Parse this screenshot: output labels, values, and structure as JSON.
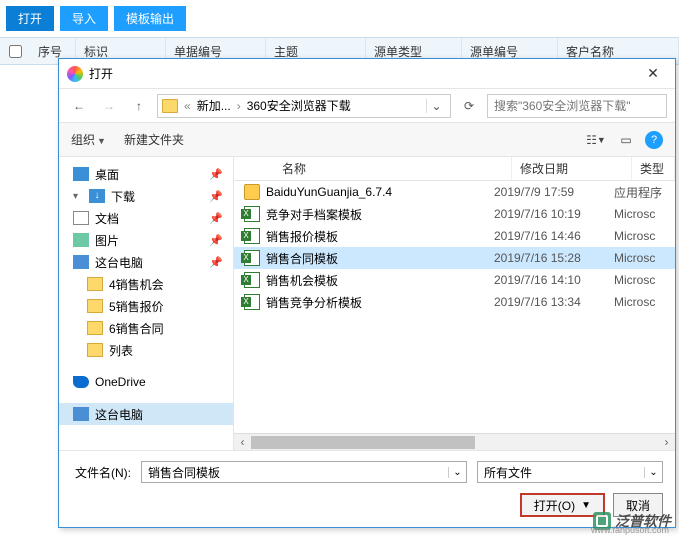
{
  "toolbar": {
    "open": "打开",
    "import": "导入",
    "template_out": "模板输出"
  },
  "grid": {
    "cols": {
      "seq": "序号",
      "mark": "标识",
      "bill_no": "单据编号",
      "subject": "主题",
      "src_type": "源单类型",
      "src_no": "源单编号",
      "cust": "客户名称"
    }
  },
  "dialog": {
    "title": "打开",
    "nav": {
      "crumb1": "新加...",
      "crumb2": "360安全浏览器下载",
      "search_ph": "搜索\"360安全浏览器下载\""
    },
    "cmd": {
      "org": "组织",
      "newf": "新建文件夹"
    },
    "tree": [
      {
        "label": "桌面",
        "icon": "desk",
        "pin": true
      },
      {
        "label": "下载",
        "icon": "down",
        "pin": true,
        "expanded": true
      },
      {
        "label": "文档",
        "icon": "doc",
        "pin": true
      },
      {
        "label": "图片",
        "icon": "pic",
        "pin": true
      },
      {
        "label": "这台电脑",
        "icon": "pc",
        "pin": true
      },
      {
        "label": "4销售机会",
        "icon": "fold",
        "sub": true
      },
      {
        "label": "5销售报价",
        "icon": "fold",
        "sub": true
      },
      {
        "label": "6销售合同",
        "icon": "fold",
        "sub": true
      },
      {
        "label": "列表",
        "icon": "fold",
        "sub": true
      },
      {
        "label": "",
        "icon": "",
        "spacer": true
      },
      {
        "label": "OneDrive",
        "icon": "one"
      },
      {
        "label": "",
        "icon": "",
        "spacer": true
      },
      {
        "label": "这台电脑",
        "icon": "pc",
        "sel": true
      }
    ],
    "files": {
      "hdr": {
        "name": "名称",
        "date": "修改日期",
        "type": "类型"
      },
      "rows": [
        {
          "icon": "exe",
          "name": "BaiduYunGuanjia_6.7.4",
          "date": "2019/7/9 17:59",
          "type": "应用程序"
        },
        {
          "icon": "xls",
          "name": "竞争对手档案模板",
          "date": "2019/7/16 10:19",
          "type": "Microsc"
        },
        {
          "icon": "xls",
          "name": "销售报价模板",
          "date": "2019/7/16 14:46",
          "type": "Microsc"
        },
        {
          "icon": "xls",
          "name": "销售合同模板",
          "date": "2019/7/16 15:28",
          "type": "Microsc",
          "sel": true
        },
        {
          "icon": "xls",
          "name": "销售机会模板",
          "date": "2019/7/16 14:10",
          "type": "Microsc"
        },
        {
          "icon": "xls",
          "name": "销售竞争分析模板",
          "date": "2019/7/16 13:34",
          "type": "Microsc"
        }
      ]
    },
    "foot": {
      "fname_lbl": "文件名(N):",
      "fname_val": "销售合同模板",
      "ftype_val": "所有文件",
      "open_btn": "打开(O)",
      "cancel_btn": "取消"
    }
  },
  "watermark": {
    "text": "泛普软件",
    "url": "www.fanpusoft.com"
  }
}
